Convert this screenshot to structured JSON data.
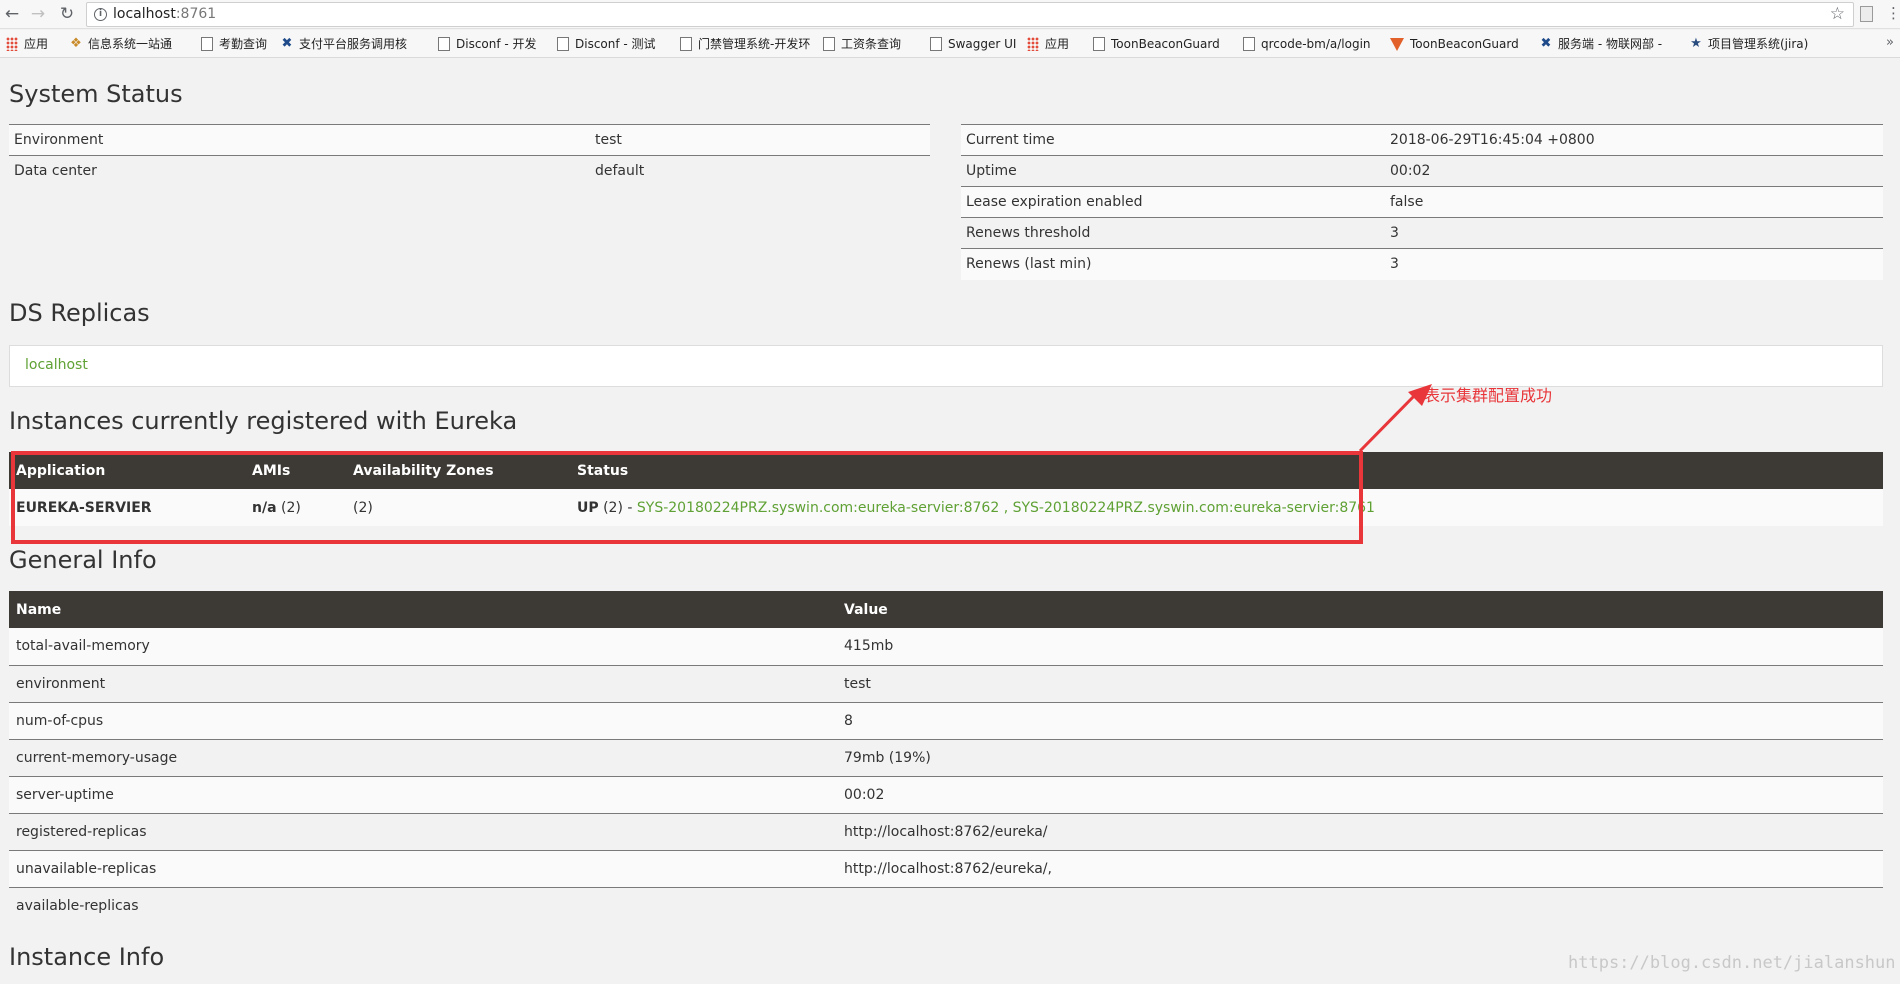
{
  "browser": {
    "url_host": "localhost",
    "url_port": ":8761",
    "bookmarks": [
      {
        "label": "应用",
        "icon": "grid-icon"
      },
      {
        "label": "信息系统一站通",
        "icon": "brand-icon"
      },
      {
        "label": "考勤查询",
        "icon": "page-icon"
      },
      {
        "label": "支付平台服务调用核",
        "icon": "tools-icon"
      },
      {
        "label": "Disconf - 开发",
        "icon": "page-icon"
      },
      {
        "label": "Disconf - 测试",
        "icon": "page-icon"
      },
      {
        "label": "门禁管理系统-开发环",
        "icon": "page-icon"
      },
      {
        "label": "工资条查询",
        "icon": "page-icon"
      },
      {
        "label": "Swagger UI",
        "icon": "page-icon"
      },
      {
        "label": "应用",
        "icon": "grid-icon"
      },
      {
        "label": "ToonBeaconGuard",
        "icon": "page-icon"
      },
      {
        "label": "qrcode-bm/a/login",
        "icon": "page-icon"
      },
      {
        "label": "ToonBeaconGuard",
        "icon": "fox-icon"
      },
      {
        "label": "服务端 - 物联网部 -",
        "icon": "tools-icon"
      },
      {
        "label": "项目管理系统(jira)",
        "icon": "mascot-icon"
      }
    ]
  },
  "system_status": {
    "title": "System Status",
    "left": [
      {
        "label": "Environment",
        "value": "test"
      },
      {
        "label": "Data center",
        "value": "default"
      }
    ],
    "right": [
      {
        "label": "Current time",
        "value": "2018-06-29T16:45:04 +0800"
      },
      {
        "label": "Uptime",
        "value": "00:02"
      },
      {
        "label": "Lease expiration enabled",
        "value": "false"
      },
      {
        "label": "Renews threshold",
        "value": "3"
      },
      {
        "label": "Renews (last min)",
        "value": "3"
      }
    ]
  },
  "ds_replicas": {
    "title": "DS Replicas",
    "link": "localhost"
  },
  "instances": {
    "title": "Instances currently registered with Eureka",
    "headers": [
      "Application",
      "AMIs",
      "Availability Zones",
      "Status"
    ],
    "row": {
      "application": "EUREKA-SERVIER",
      "amis_label": "n/a",
      "amis_count": "(2)",
      "zones": "(2)",
      "status_label": "UP",
      "status_count": "(2) -",
      "instance_1": "SYS-20180224PRZ.syswin.com:eureka-servier:8762",
      "separator": ",",
      "instance_2": "SYS-20180224PRZ.syswin.com:eureka-servier:8761"
    }
  },
  "annotation": {
    "text": "表示集群配置成功",
    "color": "#e8363a"
  },
  "general_info": {
    "title": "General Info",
    "headers": [
      "Name",
      "Value"
    ],
    "rows": [
      {
        "name": "total-avail-memory",
        "value": "415mb"
      },
      {
        "name": "environment",
        "value": "test"
      },
      {
        "name": "num-of-cpus",
        "value": "8"
      },
      {
        "name": "current-memory-usage",
        "value": "79mb (19%)"
      },
      {
        "name": "server-uptime",
        "value": "00:02"
      },
      {
        "name": "registered-replicas",
        "value": "http://localhost:8762/eureka/"
      },
      {
        "name": "unavailable-replicas",
        "value": "http://localhost:8762/eureka/,"
      },
      {
        "name": "available-replicas",
        "value": ""
      }
    ]
  },
  "instance_info": {
    "title": "Instance Info"
  },
  "watermark": "https://blog.csdn.net/jialanshun",
  "colors": {
    "header_bg": "#3d3934",
    "link_green": "#5fa134",
    "page_bg": "#f2f2f2"
  }
}
